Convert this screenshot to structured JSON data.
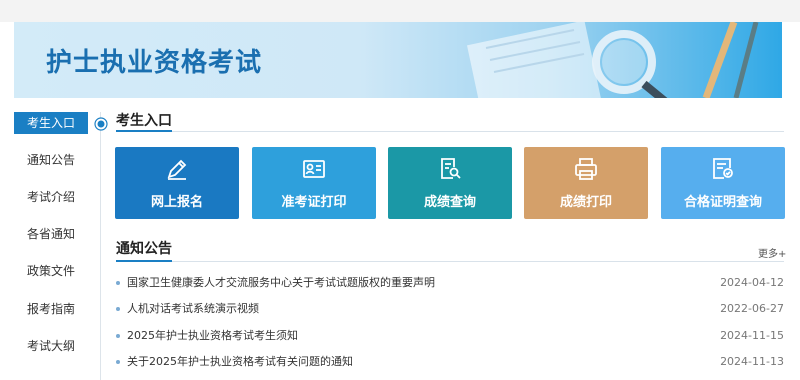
{
  "banner": {
    "title": "护士执业资格考试"
  },
  "sidebar": {
    "items": [
      {
        "label": "考生入口",
        "active": true
      },
      {
        "label": "通知公告"
      },
      {
        "label": "考试介绍"
      },
      {
        "label": "各省通知"
      },
      {
        "label": "政策文件"
      },
      {
        "label": "报考指南"
      },
      {
        "label": "考试大纲"
      }
    ]
  },
  "entry": {
    "title": "考生入口",
    "tiles": [
      {
        "label": "网上报名",
        "color": "#1a79c2",
        "icon": "pencil-icon"
      },
      {
        "label": "准考证打印",
        "color": "#2ea0dc",
        "icon": "id-card-icon"
      },
      {
        "label": "成绩查询",
        "color": "#1b98a6",
        "icon": "search-document-icon"
      },
      {
        "label": "成绩打印",
        "color": "#d4a06a",
        "icon": "printer-icon"
      },
      {
        "label": "合格证明查询",
        "color": "#56aeee",
        "icon": "certificate-icon"
      }
    ]
  },
  "notices": {
    "title": "通知公告",
    "more": "更多+",
    "items": [
      {
        "text": "国家卫生健康委人才交流服务中心关于考试试题版权的重要声明",
        "date": "2024-04-12"
      },
      {
        "text": "人机对话考试系统演示视频",
        "date": "2022-06-27"
      },
      {
        "text": "2025年护士执业资格考试考生须知",
        "date": "2024-11-15"
      },
      {
        "text": "关于2025年护士执业资格考试有关问题的通知",
        "date": "2024-11-13"
      }
    ]
  }
}
